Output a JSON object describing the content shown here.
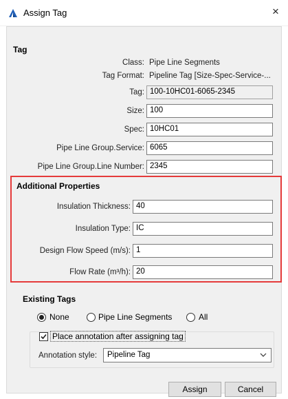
{
  "window": {
    "title": "Assign Tag",
    "close_glyph": "×"
  },
  "tag": {
    "heading": "Tag",
    "class_label": "Class:",
    "class_value": "Pipe Line Segments",
    "format_label": "Tag Format:",
    "format_value": "Pipeline Tag [Size-Spec-Service-...",
    "tag_label": "Tag:",
    "tag_value": "100-10HC01-6065-2345",
    "size_label": "Size:",
    "size_value": "100",
    "spec_label": "Spec:",
    "spec_value": "10HC01",
    "service_label": "Pipe Line Group.Service:",
    "service_value": "6065",
    "line_number_label": "Pipe Line Group.Line Number:",
    "line_number_value": "2345"
  },
  "additional": {
    "heading": "Additional Properties",
    "insulation_thickness_label": "Insulation Thickness:",
    "insulation_thickness_value": "40",
    "insulation_type_label": "Insulation Type:",
    "insulation_type_value": "IC",
    "design_flow_speed_label": "Design Flow Speed (m/s):",
    "design_flow_speed_value": "1",
    "flow_rate_label": "Flow Rate (m³/h):",
    "flow_rate_value": "20"
  },
  "existing": {
    "heading": "Existing Tags",
    "radio_none": "None",
    "radio_segments": "Pipe Line Segments",
    "radio_all": "All",
    "selected": "None"
  },
  "annotation": {
    "checkbox_label": "Place annotation after assigning tag",
    "checked": true,
    "style_label": "Annotation style:",
    "style_value": "Pipeline Tag"
  },
  "buttons": {
    "assign": "Assign",
    "cancel": "Cancel"
  },
  "colors": {
    "highlight_border": "#e53a3a",
    "app_icon": "#1f5fb8"
  }
}
